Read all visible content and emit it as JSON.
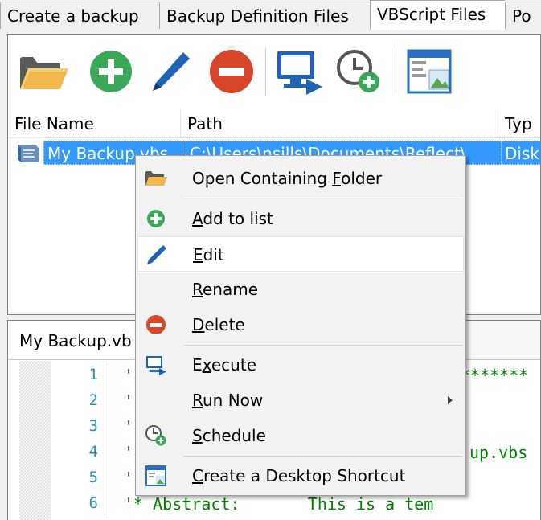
{
  "tabs": [
    {
      "label": "Create a backup"
    },
    {
      "label": "Backup Definition Files"
    },
    {
      "label": "VBScript Files"
    },
    {
      "label": "Po"
    }
  ],
  "toolbar": {
    "buttons": [
      {
        "icon": "folder-icon"
      },
      {
        "icon": "add-icon"
      },
      {
        "icon": "edit-pencil-icon"
      },
      {
        "icon": "delete-icon"
      },
      {
        "icon": "execute-icon"
      },
      {
        "icon": "schedule-icon"
      },
      {
        "icon": "desktop-shortcut-icon"
      }
    ]
  },
  "list": {
    "columns": [
      "File Name",
      "Path",
      "Typ"
    ],
    "rows": [
      {
        "name": "My Backup.vbs",
        "path": "C:\\Users\\nsills\\Documents\\Reflect\\",
        "type": "Disk"
      }
    ]
  },
  "editor": {
    "tab_label": "My Backup.vb",
    "line_numbers": [
      "1",
      "2",
      "3",
      "4",
      "5",
      "6"
    ],
    "code_lines": [
      "'  ",
      "'",
      "'",
      "'",
      "'",
      "'* Abstract:       This is a tem"
    ],
    "code_tails": {
      "line1": "*******",
      "line4": "up.vbs"
    }
  },
  "context_menu": {
    "items": [
      {
        "pre": "Open Containing ",
        "hot": "F",
        "post": "older",
        "icon": "folder-icon"
      },
      {
        "pre": "",
        "hot": "A",
        "post": "dd to list",
        "icon": "add-icon"
      },
      {
        "pre": "",
        "hot": "E",
        "post": "dit",
        "icon": "edit-pencil-icon"
      },
      {
        "pre": "",
        "hot": "R",
        "post": "ename",
        "icon": ""
      },
      {
        "pre": "",
        "hot": "D",
        "post": "elete",
        "icon": "delete-icon"
      },
      {
        "pre": "E",
        "hot": "x",
        "post": "ecute",
        "icon": "execute-icon"
      },
      {
        "pre": "",
        "hot": "R",
        "post": "un Now",
        "icon": ""
      },
      {
        "pre": "",
        "hot": "S",
        "post": "chedule",
        "icon": "schedule-icon"
      },
      {
        "pre": "",
        "hot": "C",
        "post": "reate a Desktop Shortcut",
        "icon": "desktop-shortcut-icon"
      }
    ]
  },
  "colors": {
    "selection": "#3399ff",
    "add_green": "#3aa856",
    "delete_red": "#d9472b",
    "pencil_blue": "#1e63b4",
    "code_green": "#008000",
    "line_number": "#2b91af"
  }
}
